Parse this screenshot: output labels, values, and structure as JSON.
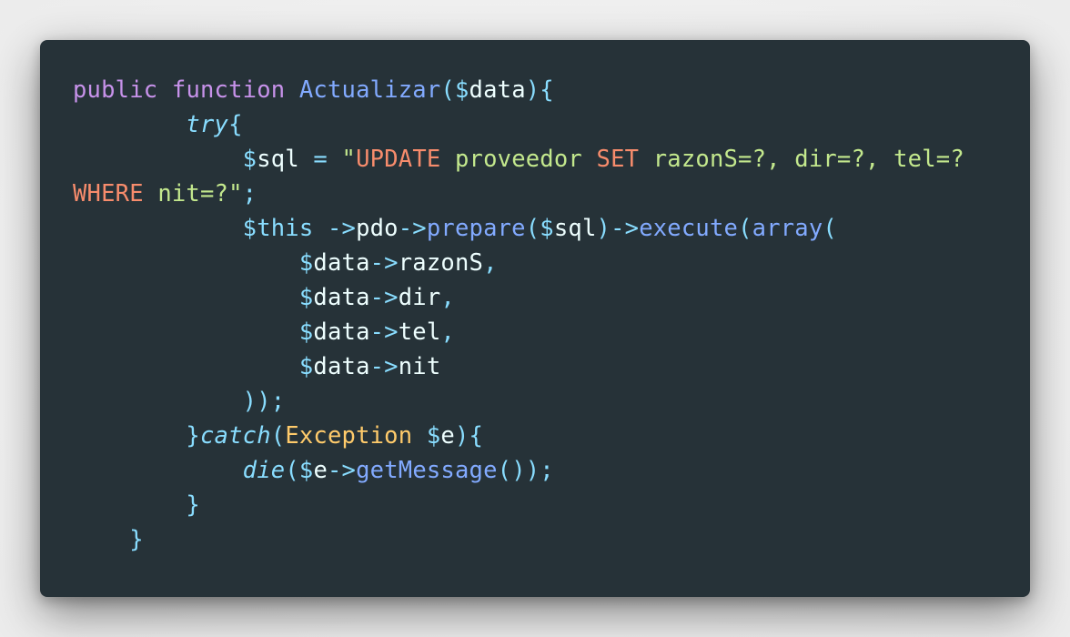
{
  "editor": {
    "language": "php",
    "background": "#263238",
    "lines": [
      [
        {
          "t": "public",
          "k": "keyword"
        },
        {
          "t": " ",
          "k": "plain"
        },
        {
          "t": "function",
          "k": "keyword"
        },
        {
          "t": " ",
          "k": "plain"
        },
        {
          "t": "Actualizar",
          "k": "function"
        },
        {
          "t": "(",
          "k": "punct"
        },
        {
          "t": "$",
          "k": "punct"
        },
        {
          "t": "data",
          "k": "var"
        },
        {
          "t": "){",
          "k": "punct"
        }
      ],
      [
        {
          "t": "        ",
          "k": "plain"
        },
        {
          "t": "try",
          "k": "italic"
        },
        {
          "t": "{",
          "k": "punct"
        }
      ],
      [
        {
          "t": "            ",
          "k": "plain"
        },
        {
          "t": "$",
          "k": "punct"
        },
        {
          "t": "sql",
          "k": "var"
        },
        {
          "t": " = ",
          "k": "punct"
        },
        {
          "t": "\"",
          "k": "string"
        },
        {
          "t": "UPDATE",
          "k": "sqlkw"
        },
        {
          "t": " proveedor ",
          "k": "string"
        },
        {
          "t": "SET",
          "k": "sqlkw"
        },
        {
          "t": " razonS=?, dir=?, tel=?",
          "k": "string"
        }
      ],
      [
        {
          "t": "WHERE",
          "k": "sqlkw"
        },
        {
          "t": " nit=?\"",
          "k": "string"
        },
        {
          "t": ";",
          "k": "punct"
        }
      ],
      [
        {
          "t": "            ",
          "k": "plain"
        },
        {
          "t": "$this",
          "k": "punct"
        },
        {
          "t": " ->",
          "k": "punct"
        },
        {
          "t": "pdo",
          "k": "var"
        },
        {
          "t": "->",
          "k": "punct"
        },
        {
          "t": "prepare",
          "k": "function"
        },
        {
          "t": "(",
          "k": "punct"
        },
        {
          "t": "$",
          "k": "punct"
        },
        {
          "t": "sql",
          "k": "var"
        },
        {
          "t": ")->",
          "k": "punct"
        },
        {
          "t": "execute",
          "k": "function"
        },
        {
          "t": "(",
          "k": "punct"
        },
        {
          "t": "array",
          "k": "function"
        },
        {
          "t": "(",
          "k": "punct"
        }
      ],
      [
        {
          "t": "                ",
          "k": "plain"
        },
        {
          "t": "$",
          "k": "punct"
        },
        {
          "t": "data",
          "k": "var"
        },
        {
          "t": "->",
          "k": "punct"
        },
        {
          "t": "razonS",
          "k": "var"
        },
        {
          "t": ",",
          "k": "punct"
        }
      ],
      [
        {
          "t": "                ",
          "k": "plain"
        },
        {
          "t": "$",
          "k": "punct"
        },
        {
          "t": "data",
          "k": "var"
        },
        {
          "t": "->",
          "k": "punct"
        },
        {
          "t": "dir",
          "k": "var"
        },
        {
          "t": ",",
          "k": "punct"
        }
      ],
      [
        {
          "t": "                ",
          "k": "plain"
        },
        {
          "t": "$",
          "k": "punct"
        },
        {
          "t": "data",
          "k": "var"
        },
        {
          "t": "->",
          "k": "punct"
        },
        {
          "t": "tel",
          "k": "var"
        },
        {
          "t": ",",
          "k": "punct"
        }
      ],
      [
        {
          "t": "                ",
          "k": "plain"
        },
        {
          "t": "$",
          "k": "punct"
        },
        {
          "t": "data",
          "k": "var"
        },
        {
          "t": "->",
          "k": "punct"
        },
        {
          "t": "nit",
          "k": "var"
        }
      ],
      [
        {
          "t": "            ",
          "k": "plain"
        },
        {
          "t": "));",
          "k": "punct"
        }
      ],
      [
        {
          "t": "        ",
          "k": "plain"
        },
        {
          "t": "}",
          "k": "punct"
        },
        {
          "t": "catch",
          "k": "italic"
        },
        {
          "t": "(",
          "k": "punct"
        },
        {
          "t": "Exception",
          "k": "class"
        },
        {
          "t": " ",
          "k": "plain"
        },
        {
          "t": "$",
          "k": "punct"
        },
        {
          "t": "e",
          "k": "var"
        },
        {
          "t": "){",
          "k": "punct"
        }
      ],
      [
        {
          "t": "            ",
          "k": "plain"
        },
        {
          "t": "die",
          "k": "italic"
        },
        {
          "t": "(",
          "k": "punct"
        },
        {
          "t": "$",
          "k": "punct"
        },
        {
          "t": "e",
          "k": "var"
        },
        {
          "t": "->",
          "k": "punct"
        },
        {
          "t": "getMessage",
          "k": "function"
        },
        {
          "t": "());",
          "k": "punct"
        }
      ],
      [
        {
          "t": "        ",
          "k": "plain"
        },
        {
          "t": "}",
          "k": "punct"
        }
      ],
      [
        {
          "t": "    ",
          "k": "plain"
        },
        {
          "t": "}",
          "k": "punct"
        }
      ]
    ]
  }
}
